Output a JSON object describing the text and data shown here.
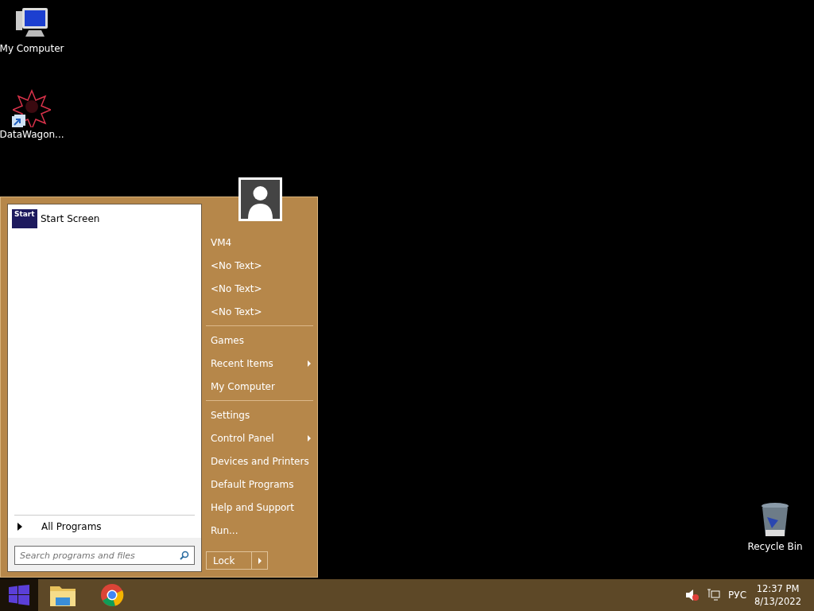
{
  "desktop_icons": [
    {
      "label": "My Computer",
      "kind": "computer",
      "shortcut": false
    },
    {
      "label": "DataWagon...",
      "kind": "star",
      "shortcut": true
    },
    {
      "label": "Recycle Bin",
      "kind": "bin",
      "shortcut": false
    }
  ],
  "start_menu": {
    "pinned": [
      {
        "label": "Start Screen",
        "tile": "Start"
      }
    ],
    "all_programs": "All Programs",
    "search": {
      "placeholder": "Search programs and files"
    },
    "right_groups": [
      [
        {
          "label": "VM4",
          "submenu": false
        },
        {
          "label": "<No Text>",
          "submenu": false
        },
        {
          "label": "<No Text>",
          "submenu": false
        },
        {
          "label": "<No Text>",
          "submenu": false
        }
      ],
      [
        {
          "label": "Games",
          "submenu": false
        },
        {
          "label": "Recent Items",
          "submenu": true
        },
        {
          "label": "My Computer",
          "submenu": false
        }
      ],
      [
        {
          "label": "Settings",
          "submenu": false
        },
        {
          "label": "Control Panel",
          "submenu": true
        },
        {
          "label": "Devices and Printers",
          "submenu": false
        },
        {
          "label": "Default Programs",
          "submenu": false
        },
        {
          "label": "Help and Support",
          "submenu": false
        },
        {
          "label": "Run...",
          "submenu": false
        }
      ]
    ],
    "power_button": "Lock"
  },
  "taskbar": {
    "apps": [
      {
        "kind": "explorer"
      },
      {
        "kind": "chrome"
      }
    ],
    "language": "РУС",
    "time": "12:37 PM",
    "date": "8/13/2022"
  }
}
